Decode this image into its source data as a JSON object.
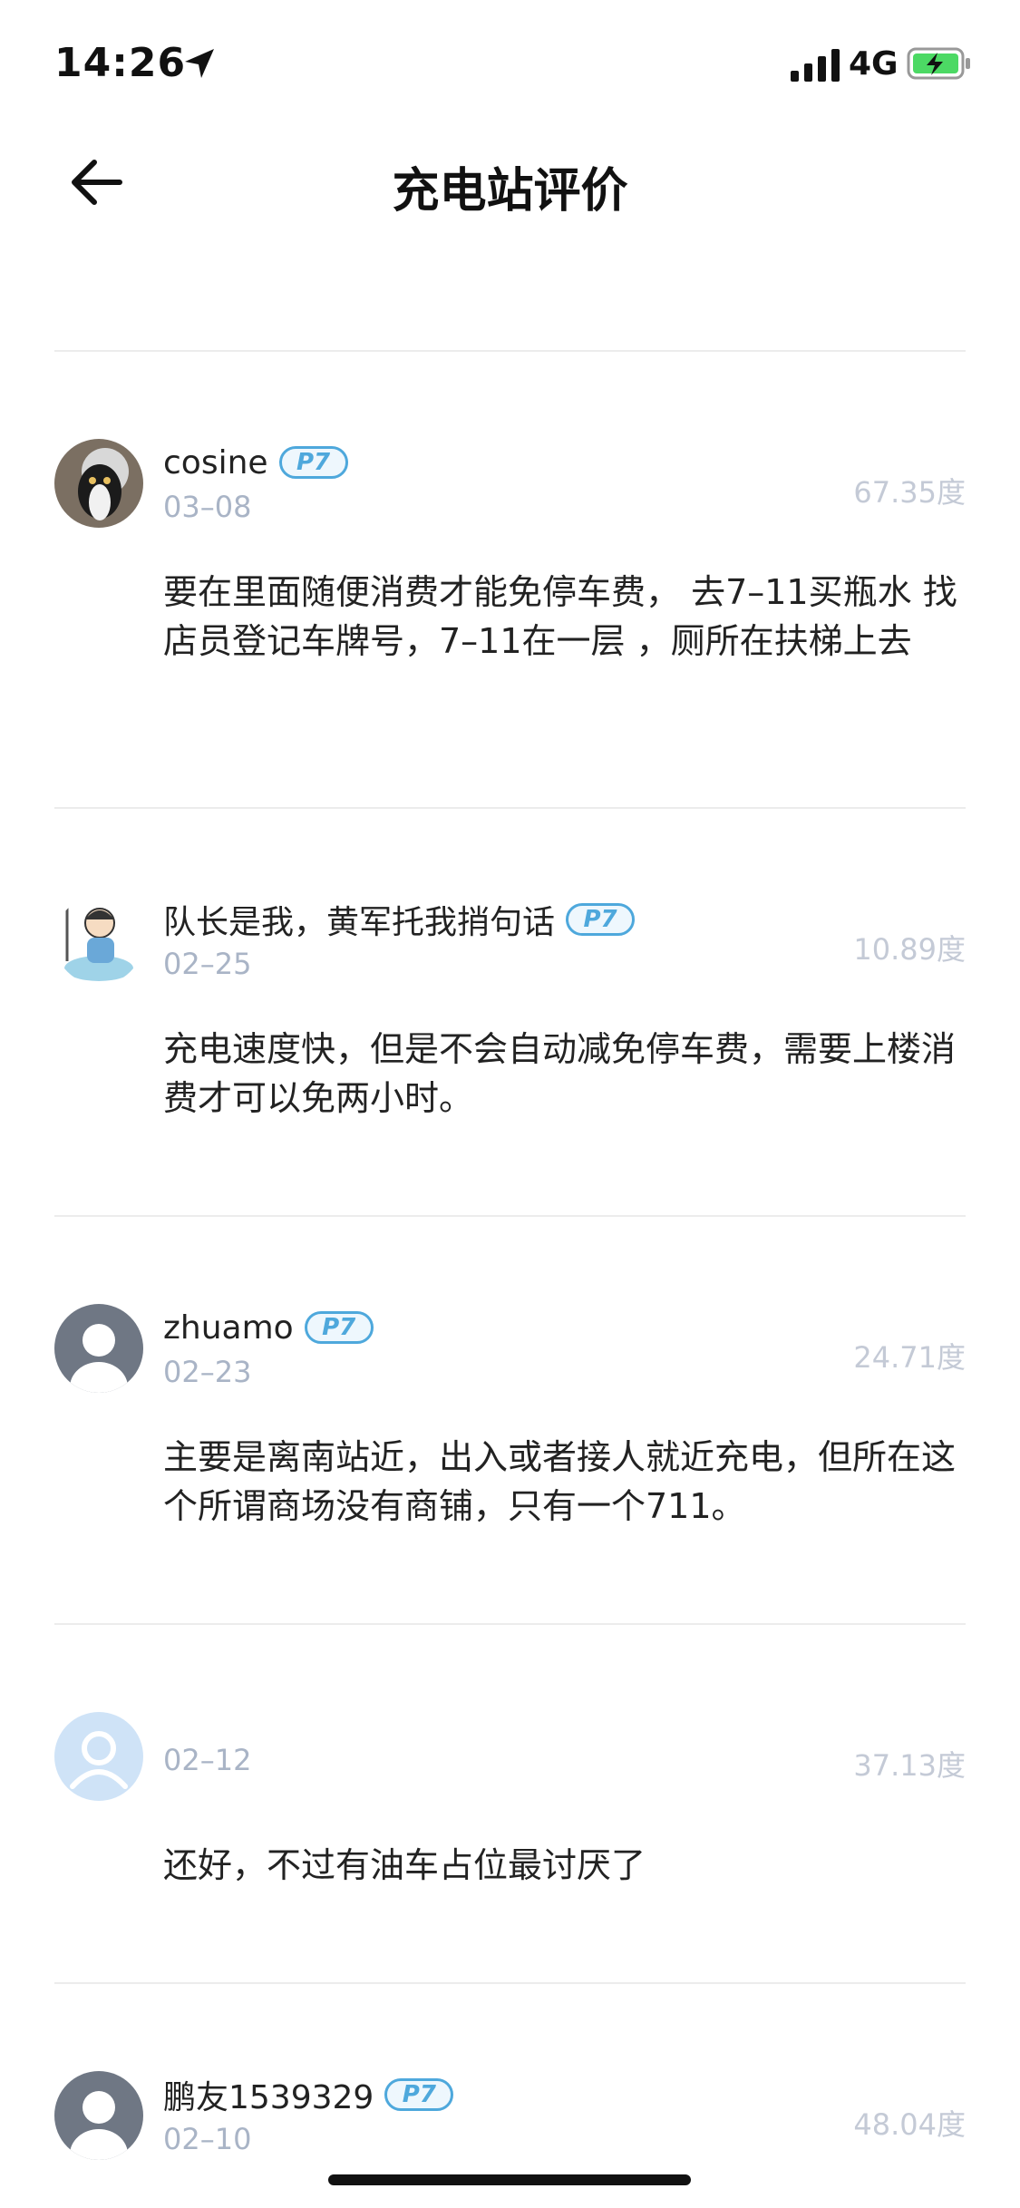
{
  "status": {
    "time": "14:26",
    "network": "4G"
  },
  "nav": {
    "title": "充电站评价"
  },
  "reviews": [
    {
      "name": "cosine",
      "badge": "P7",
      "date": "03–08",
      "energy": "67.35度",
      "content": "要在里面随便消费才能免停车费， 去7–11买瓶水 找店员登记车牌号，7–11在一层 ，厕所在扶梯上去"
    },
    {
      "name": "队长是我，黄军托我捎句话",
      "badge": "P7",
      "date": "02–25",
      "energy": "10.89度",
      "content": "充电速度快，但是不会自动减免停车费，需要上楼消费才可以免两小时。"
    },
    {
      "name": "zhuamo",
      "badge": "P7",
      "date": "02–23",
      "energy": "24.71度",
      "content": "主要是离南站近，出入或者接人就近充电，但所在这个所谓商场没有商铺，只有一个711。"
    },
    {
      "name": "",
      "badge": "",
      "date": "02–12",
      "energy": "37.13度",
      "content": "还好，不过有油车占位最讨厌了"
    },
    {
      "name": "鹏友1539329",
      "badge": "P7",
      "date": "02–10",
      "energy": "48.04度",
      "content": ""
    }
  ],
  "icons": {
    "back": "arrow-left-icon",
    "location": "location-arrow-icon",
    "signal": "signal-icon",
    "battery": "battery-charging-icon"
  },
  "colors": {
    "badge": "#4ea8dc",
    "date": "#a9b4c6",
    "energy": "#c4cad6",
    "divider": "#ececec"
  }
}
